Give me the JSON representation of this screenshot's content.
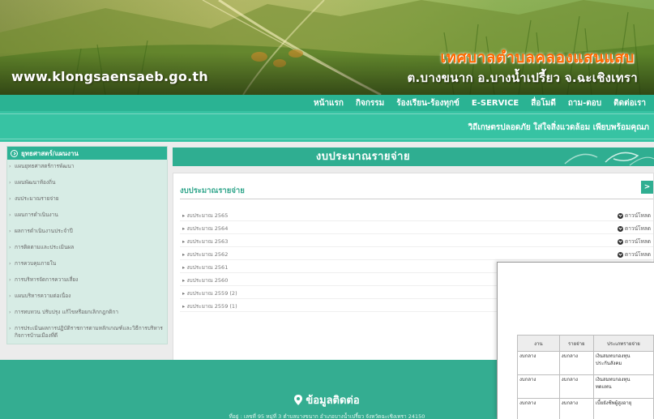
{
  "header": {
    "site_url": "www.klongsaensaeb.go.th",
    "org_title": "เทศบาลตำบลคลองแสนแสบ",
    "org_subtitle": "ต.บางขนาก อ.บางน้ำเปรี้ยว จ.ฉะเชิงเทรา"
  },
  "nav": {
    "items": [
      "หน้าแรก",
      "กิจกรรม",
      "ร้องเรียน-ร้องทุกข์",
      "E-SERVICE",
      "สื่อโมดี",
      "ถาม-ตอบ",
      "ติดต่อเรา"
    ]
  },
  "marquee": {
    "text": "วิถีเกษตรปลอดภัย ใส่ใจสิ่งแวดล้อม เพียบพร้อมคุณภ"
  },
  "sidebar": {
    "heading": "ยุทธศาสตร์/แผนงาน",
    "items": [
      "แผนยุทธศาสตร์การพัฒนา",
      "แผนพัฒนาท้องถิ่น",
      "งบประมาณรายจ่าย",
      "แผนการดำเนินงาน",
      "ผลการดำเนินงานประจำปี",
      "การติดตามและประเมินผล",
      "การควบคุมภายใน",
      "การบริหารจัดการความเสี่ยง",
      "แผนบริหารความต่อเนื่อง",
      "การทบทวน ปรับปรุง แก้ไขหรือยกเลิกกฎกติกา",
      "การประเมินผลการปฏิบัติราชการตามหลักเกณฑ์และวิธีการบริหารกิจการบ้านเมืองที่ดี"
    ]
  },
  "main": {
    "title": "งบประมาณรายจ่าย",
    "card_title": "งบประมาณรายจ่าย",
    "next_label": ">",
    "download_label": "ดาวน์โหลด",
    "rows": [
      {
        "label": "งบประมาณ 2565",
        "download": true
      },
      {
        "label": "งบประมาณ 2564",
        "download": true
      },
      {
        "label": "งบประมาณ 2563",
        "download": true
      },
      {
        "label": "งบประมาณ 2562",
        "download": true
      },
      {
        "label": "งบประมาณ 2561",
        "download": false
      },
      {
        "label": "งบประมาณ 2560",
        "download": false
      },
      {
        "label": "งบประมาณ 2559 (2)",
        "download": false
      },
      {
        "label": "งบประมาณ 2559 (1)",
        "download": false
      }
    ]
  },
  "popup": {
    "columns": [
      "งาน",
      "รายจ่าย",
      "ประเภทรายจ่าย"
    ],
    "rows": [
      [
        "งบกลาง",
        "งบกลาง",
        "เงินสมทบกองทุน\nประกันสังคม"
      ],
      [
        "งบกลาง",
        "งบกลาง",
        "เงินสมทบกองทุน\nทดแทน"
      ],
      [
        "งบกลาง",
        "งบกลาง",
        "เบี้ยยังชีพผู้สูงอายุ\n"
      ]
    ]
  },
  "footer": {
    "title": "ข้อมูลติดต่อ",
    "address": "ที่อยู่ : เลขที่ 95 หมู่ที่ 3 ตำบลบางขนาก อำเภอบางน้ำเปรี้ยว จังหวัดฉะเชิงเทรา 24150"
  },
  "colors": {
    "brand_green": "#2ab393",
    "title_orange": "#ff6a00"
  }
}
